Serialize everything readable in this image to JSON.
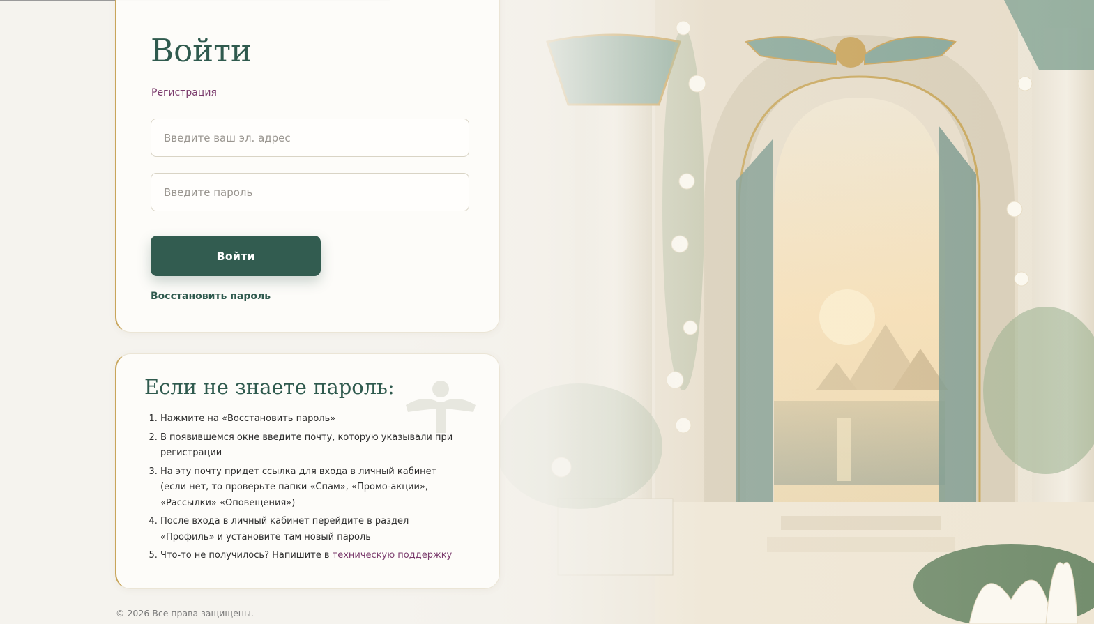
{
  "login": {
    "title": "Войти",
    "register_link": "Регистрация",
    "email_placeholder": "Введите ваш эл. адрес",
    "password_placeholder": "Введите пароль",
    "submit_label": "Войти",
    "restore_link": "Восстановить пароль"
  },
  "help": {
    "title": "Если не знаете пароль:",
    "steps": [
      "Нажмите на «Восстановить пароль»",
      "В появившемся окне введите почту, которую указывали при регистрации",
      "На эту почту придет ссылка для входа в личный кабинет (если нет, то проверьте папки «Спам», «Промо-акции», «Рассылки» «Оповещения»)",
      "После входа в личный кабинет перейдите в раздел «Профиль» и установите там новый пароль"
    ],
    "last_step_text": "Что-то не получилось? Напишите в ",
    "support_link": "техническую поддержку"
  },
  "footer": {
    "copyright": "© 2026 Все права защищены."
  },
  "colors": {
    "accent_green": "#325c50",
    "gold_border": "#c8a55a",
    "link_purple": "#7a3a6c",
    "page_background": "#f5f3ee"
  },
  "icons": {
    "background": "egyptian-temple-illustration",
    "card_emblem": "winged-sun-emblem"
  }
}
